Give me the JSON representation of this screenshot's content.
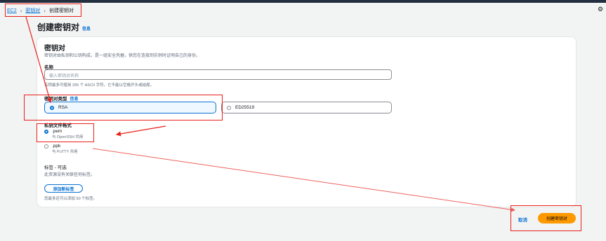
{
  "breadcrumb": {
    "root": "EC2",
    "section": "密钥对",
    "current": "创建密钥对"
  },
  "page": {
    "title": "创建密钥对",
    "info_link": "信息"
  },
  "keypair": {
    "section_title": "密钥对",
    "description": "密钥对由私钥和公钥构成，是一组安全凭据，供您在连接到实例时证明自己的身份。",
    "name_label": "名称",
    "name_placeholder": "输入密钥对名称",
    "name_hint": "名称最多可使用 255 个 ASCII 字符。它不能以空格开头或结尾。",
    "type_label": "密钥对类型",
    "type_info": "信息",
    "types": [
      {
        "label": "RSA",
        "selected": true
      },
      {
        "label": "ED25519",
        "selected": false
      }
    ],
    "format_label": "私钥文件格式",
    "formats": [
      {
        "label": ".pem",
        "hint": "与 OpenSSH 共用",
        "selected": true
      },
      {
        "label": ".ppk",
        "hint": "与 PuTTY 共用",
        "selected": false
      }
    ],
    "tags_label": "标签 - 可选",
    "tags_desc": "此资源没有关联任何标签。",
    "add_tag_button": "添加新标签",
    "tags_hint": "您最多还可以添加 50 个标签。"
  },
  "footer": {
    "cancel": "取消",
    "create": "创建密钥对"
  },
  "colors": {
    "accent": "#0972d3",
    "primary_button": "#ff9900",
    "annotation": "#e8211b"
  }
}
